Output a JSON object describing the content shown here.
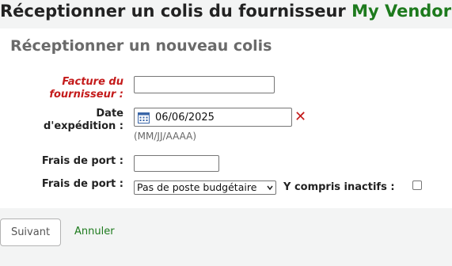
{
  "page": {
    "title_prefix": "Réceptionner un colis du fournisseur",
    "vendor_name": "My Vendor"
  },
  "form": {
    "section_title": "Réceptionner un nouveau colis",
    "invoice": {
      "label_line1": "Facture du",
      "label_line2": "fournisseur :",
      "value": ""
    },
    "shipment_date": {
      "label_line1": "Date",
      "label_line2": "d'expédition :",
      "value": "06/06/2025",
      "format_hint": "(MM/JJ/AAAA)"
    },
    "shipping_cost": {
      "label": "Frais de port :",
      "value": ""
    },
    "shipping_fund": {
      "label": "Frais de port :",
      "selected": "Pas de poste budgétaire",
      "include_inactive_label": "Y compris inactifs :",
      "include_inactive_checked": false
    }
  },
  "actions": {
    "next_label": "Suivant",
    "cancel_label": "Annuler"
  },
  "icons": {
    "calendar": "calendar-icon",
    "clear": "clear-date-icon",
    "dropdown": "chevron-down-icon"
  },
  "colors": {
    "vendor": "#1d7a1d",
    "required": "#c41b1b",
    "section_title": "#6a6a6a"
  }
}
